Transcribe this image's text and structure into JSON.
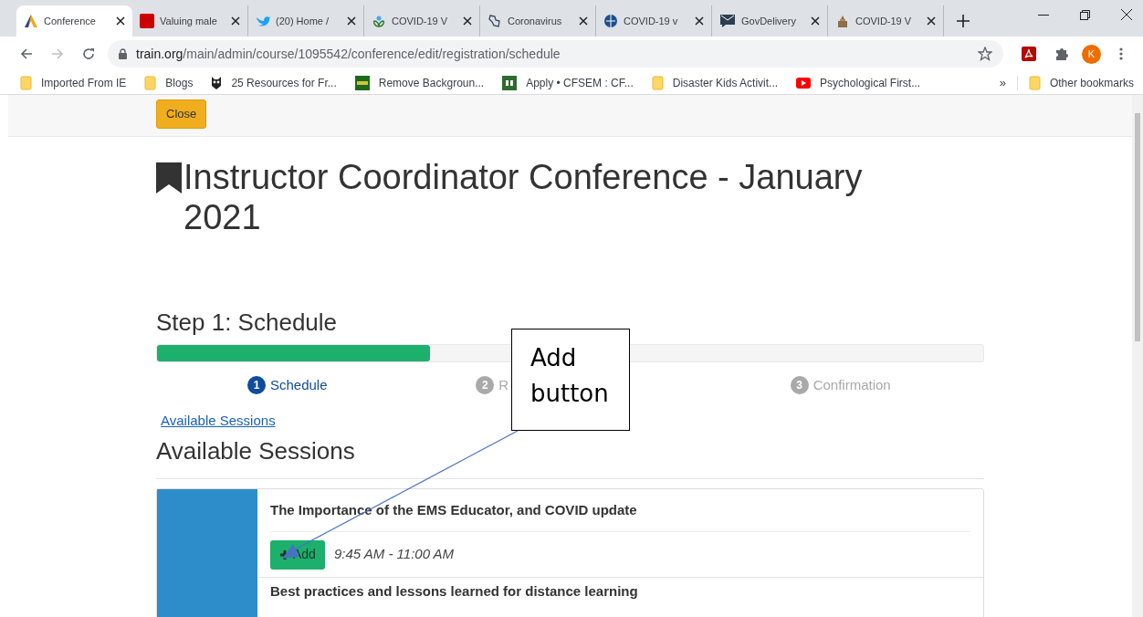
{
  "browser": {
    "tabs": [
      {
        "title": "Conference",
        "selected": true
      },
      {
        "title": "Valuing male",
        "selected": false
      },
      {
        "title": "(20) Home /",
        "selected": false
      },
      {
        "title": "COVID-19 V",
        "selected": false
      },
      {
        "title": "Coronavirus",
        "selected": false
      },
      {
        "title": "COVID-19 v",
        "selected": false
      },
      {
        "title": "GovDelivery",
        "selected": false
      },
      {
        "title": "COVID-19 V",
        "selected": false
      }
    ],
    "url_host": "train.org",
    "url_path": "/main/admin/course/1095542/conference/edit/registration/schedule",
    "profile_initial": "K",
    "bookmarks": [
      {
        "label": "Imported From IE"
      },
      {
        "label": "Blogs"
      },
      {
        "label": "25 Resources for Fr..."
      },
      {
        "label": "Remove Backgroun..."
      },
      {
        "label": "Apply • CFSEM : CF..."
      },
      {
        "label": "Disaster Kids Activit..."
      },
      {
        "label": "Psychological First..."
      }
    ],
    "overflow": "»",
    "other_bookmarks": "Other bookmarks"
  },
  "page": {
    "close_button": "Close",
    "title": "Instructor Coordinator Conference - January 2021",
    "step_heading": "Step 1: Schedule",
    "progress": {
      "level": 0.33
    },
    "steps": [
      {
        "number": "1",
        "label": "Schedule",
        "selected": true
      },
      {
        "number": "2",
        "label": "R",
        "selected": false
      },
      {
        "number": "3",
        "label": "Confirmation",
        "selected": false
      }
    ],
    "link": "Available Sessions",
    "sessions_heading": "Available Sessions",
    "sessions": [
      {
        "title": "The Importance of the EMS Educator, and COVID update",
        "button": "Add",
        "time": "9:45 AM - 11:00 AM"
      },
      {
        "title": "Best practices and lessons learned for distance learning"
      }
    ]
  },
  "annotation": {
    "text": "Add button"
  }
}
